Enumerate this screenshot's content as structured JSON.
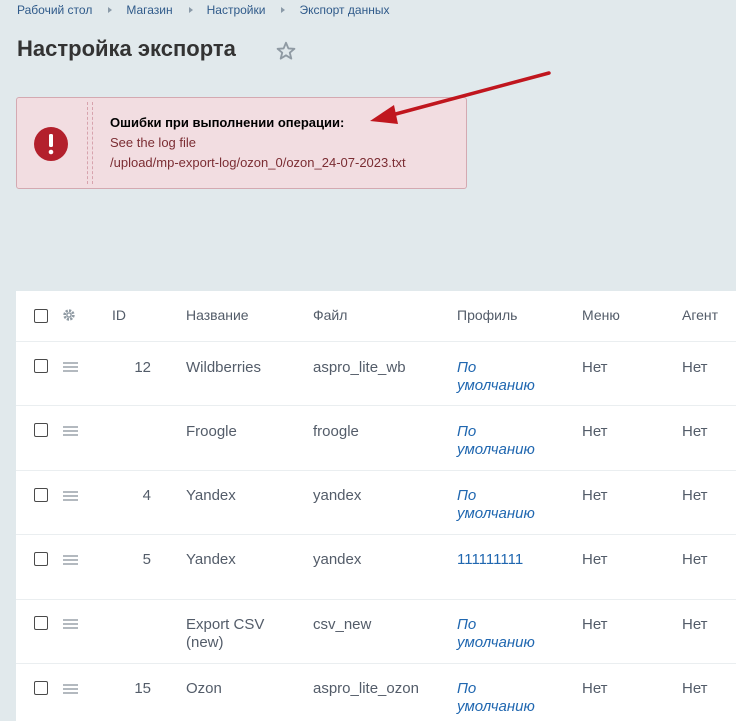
{
  "breadcrumb": [
    "Рабочий стол",
    "Магазин",
    "Настройки",
    "Экспорт данных"
  ],
  "page_title": "Настройка экспорта",
  "alert": {
    "title": "Ошибки при выполнении операции:",
    "line1": "See the log file",
    "line2": "/upload/mp-export-log/ozon_0/ozon_24-07-2023.txt"
  },
  "table": {
    "headers": {
      "id": "ID",
      "name": "Название",
      "file": "Файл",
      "profile": "Профиль",
      "menu": "Меню",
      "agent": "Агент"
    },
    "rows": [
      {
        "id": "12",
        "name": "Wildberries",
        "file": "aspro_lite_wb",
        "profile": "По\nумолчанию",
        "menu": "Нет",
        "agent": "Нет"
      },
      {
        "id": "",
        "name": "Froogle",
        "file": "froogle",
        "profile": "По\nумолчанию",
        "menu": "Нет",
        "agent": "Нет"
      },
      {
        "id": "4",
        "name": "Yandex",
        "file": "yandex",
        "profile": "По\nумолчанию",
        "menu": "Нет",
        "agent": "Нет"
      },
      {
        "id": "5",
        "name": "Yandex",
        "file": "yandex",
        "profile": "111111111",
        "menu": "Нет",
        "agent": "Нет"
      },
      {
        "id": "",
        "name": "Export CSV\n(new)",
        "file": "csv_new",
        "profile": "По\nумолчанию",
        "menu": "Нет",
        "agent": "Нет"
      },
      {
        "id": "15",
        "name": "Ozon",
        "file": "aspro_lite_ozon",
        "profile": "По\nумолчанию",
        "menu": "Нет",
        "agent": "Нет"
      }
    ]
  },
  "colors": {
    "accent": "#2067b0",
    "alert_bg": "#f2dde1",
    "alert_icon": "#b3202c",
    "arrow": "#c0161e"
  }
}
